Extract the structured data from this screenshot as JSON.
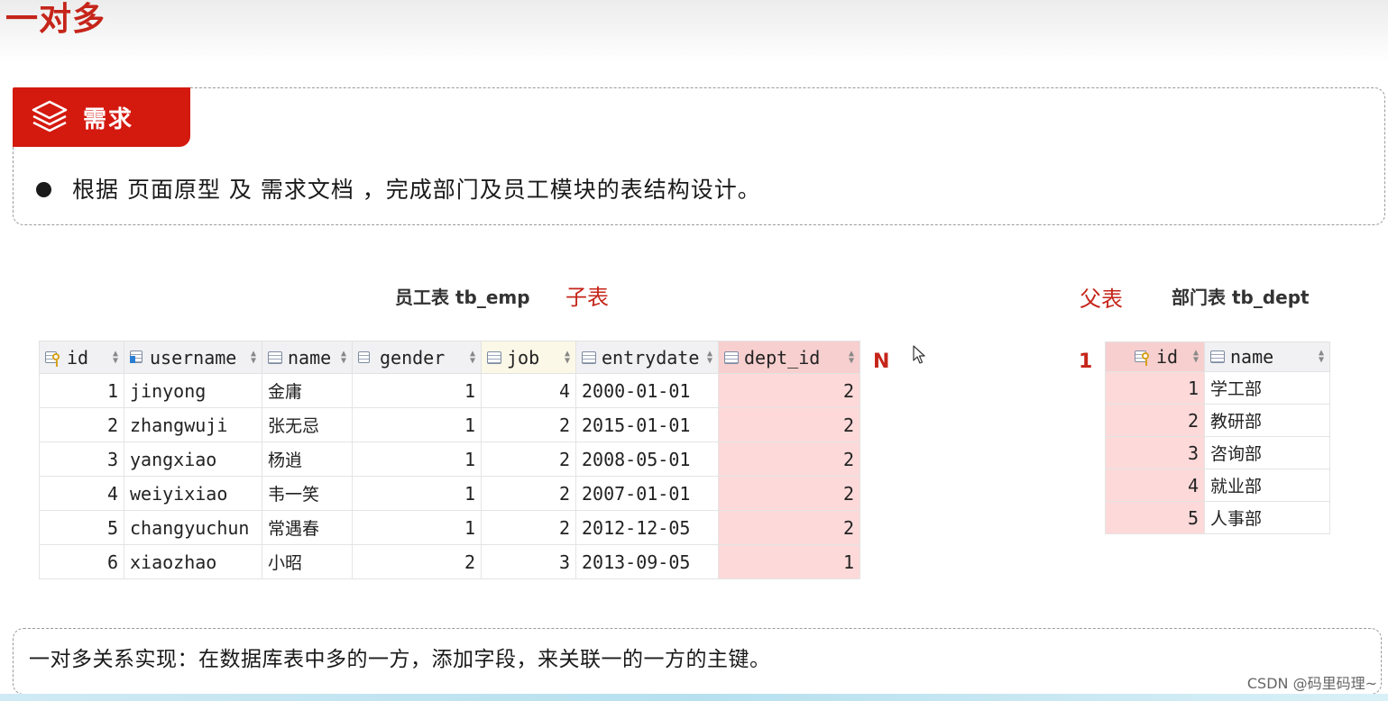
{
  "title": "一对多",
  "requirement": {
    "tag": "需求",
    "bullet": "根据 页面原型 及 需求文档 ，完成部门及员工模块的表结构设计。"
  },
  "emp_table": {
    "label": "员工表 tb_emp",
    "role": "子表",
    "cardinality": "N",
    "columns": [
      "id",
      "username",
      "name",
      "gender",
      "job",
      "entrydate",
      "dept_id"
    ],
    "rows": [
      [
        "1",
        "jinyong",
        "金庸",
        "1",
        "4",
        "2000-01-01",
        "2"
      ],
      [
        "2",
        "zhangwuji",
        "张无忌",
        "1",
        "2",
        "2015-01-01",
        "2"
      ],
      [
        "3",
        "yangxiao",
        "杨逍",
        "1",
        "2",
        "2008-05-01",
        "2"
      ],
      [
        "4",
        "weiyixiao",
        "韦一笑",
        "1",
        "2",
        "2007-01-01",
        "2"
      ],
      [
        "5",
        "changyuchun",
        "常遇春",
        "1",
        "2",
        "2012-12-05",
        "2"
      ],
      [
        "6",
        "xiaozhao",
        "小昭",
        "2",
        "3",
        "2013-09-05",
        "1"
      ]
    ]
  },
  "dept_table": {
    "label": "部门表 tb_dept",
    "role": "父表",
    "cardinality": "1",
    "columns": [
      "id",
      "name"
    ],
    "rows": [
      [
        "1",
        "学工部"
      ],
      [
        "2",
        "教研部"
      ],
      [
        "3",
        "咨询部"
      ],
      [
        "4",
        "就业部"
      ],
      [
        "5",
        "人事部"
      ]
    ]
  },
  "note": "一对多关系实现：在数据库表中多的一方，添加字段，来关联一的一方的主键。",
  "watermark": "CSDN @码里码理~",
  "colors": {
    "accent": "#c5251a",
    "tag_bg": "#d4190f",
    "highlight": "#fdd9d9"
  }
}
